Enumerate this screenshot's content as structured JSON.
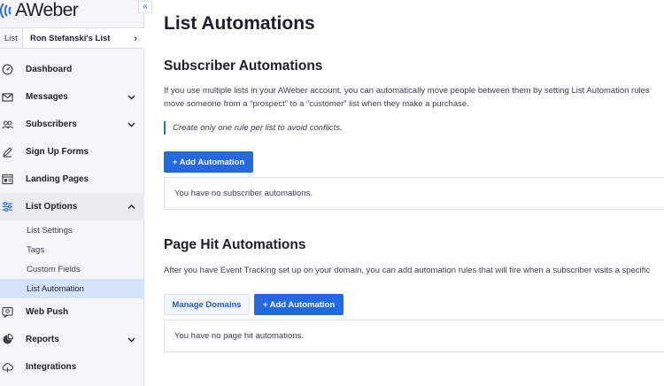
{
  "app": {
    "brand": "AWeber",
    "collapse_icon": "«"
  },
  "list_selector": {
    "tag": "List",
    "name": "Ron Stefanski's List",
    "chevron": "›"
  },
  "nav": {
    "dashboard": "Dashboard",
    "messages": "Messages",
    "subscribers": "Subscribers",
    "sign_up_forms": "Sign Up Forms",
    "landing_pages": "Landing Pages",
    "list_options": "List Options",
    "list_options_sub": [
      "List Settings",
      "Tags",
      "Custom Fields",
      "List Automation"
    ],
    "web_push": "Web Push",
    "reports": "Reports",
    "integrations": "Integrations"
  },
  "colors": {
    "accent": "#2369e0",
    "active_bg": "#d5e4fb",
    "sidebar_bg": "#f5f6f8"
  },
  "main": {
    "title": "List Automations",
    "subscriber": {
      "title": "Subscriber Automations",
      "desc_line1": "If you use multiple lists in your AWeber account, you can automatically move people between them by setting List Automation rules",
      "desc_line2": "move someone from a “prospect” to a “customer” list when they make a purchase.",
      "note": "Create only one rule per list to avoid conflicts.",
      "add_button": "+ Add Automation",
      "empty": "You have no subscriber automations."
    },
    "page_hit": {
      "title": "Page Hit Automations",
      "desc": "After you have Event Tracking set up on your domain, you can add automation rules that will fire when a subscriber visits a specific",
      "manage_button": "Manage Domains",
      "add_button": "+ Add Automation",
      "empty": "You have no page hit automations."
    }
  }
}
